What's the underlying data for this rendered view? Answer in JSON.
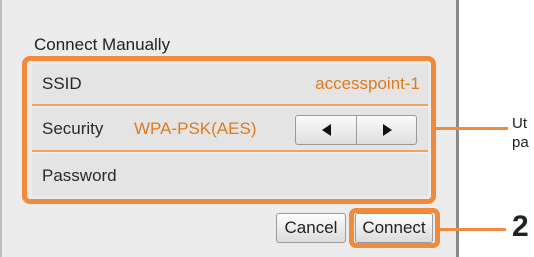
{
  "dialog": {
    "title": "Connect Manually",
    "ssid": {
      "label": "SSID",
      "value": "accesspoint-1"
    },
    "security": {
      "label": "Security",
      "value": "WPA-PSK(AES)",
      "prev_icon": "triangle-left",
      "next_icon": "triangle-right"
    },
    "password": {
      "label": "Password"
    },
    "cancel_label": "Cancel",
    "connect_label": "Connect"
  },
  "annotations": {
    "callout_line1": "Ut",
    "callout_line2": "pa",
    "step": "2",
    "highlight_color": "#f08a3c"
  },
  "colors": {
    "value_text": "#e07a1f",
    "panel_bg": "#ececec"
  }
}
